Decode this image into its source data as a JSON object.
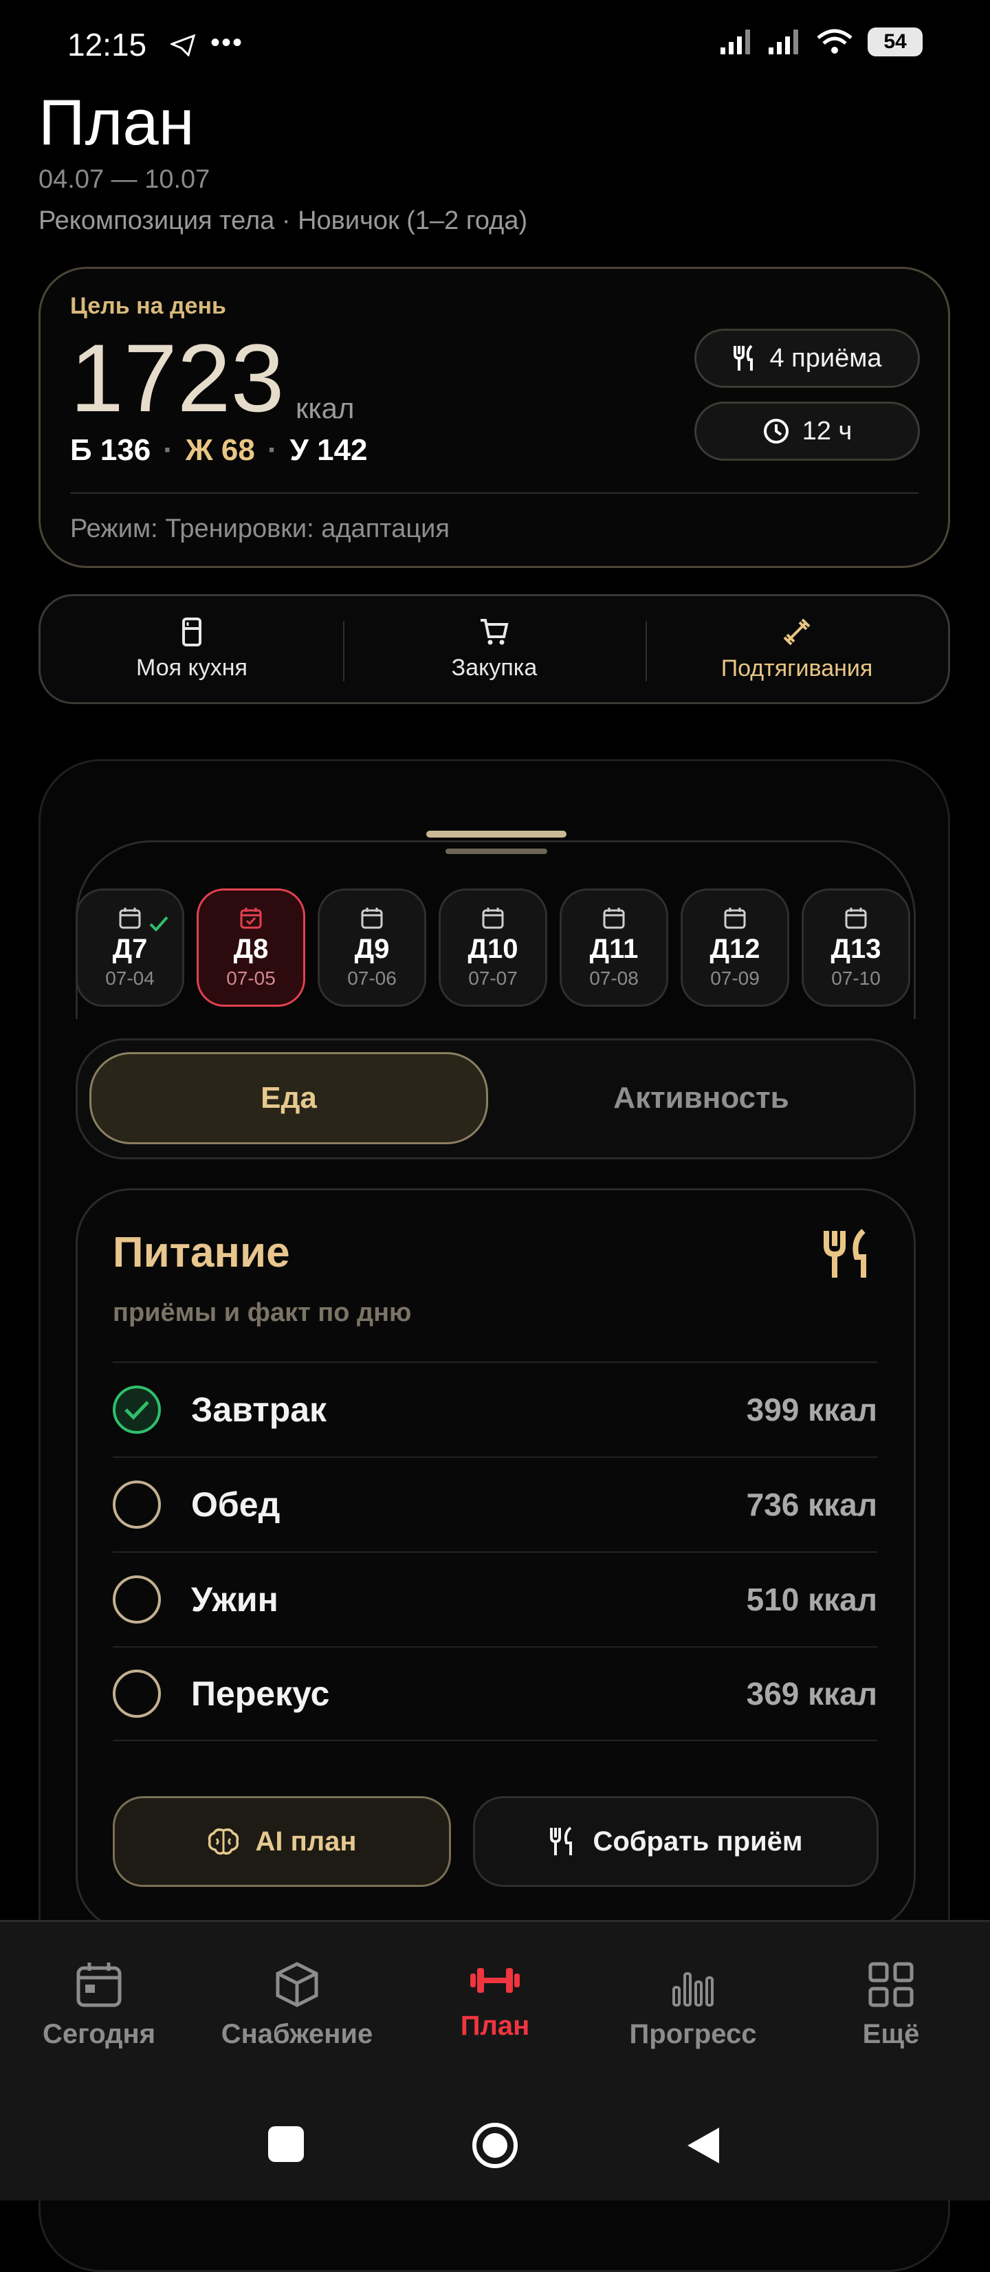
{
  "status": {
    "time": "12:15",
    "battery": "54"
  },
  "header": {
    "title": "План",
    "dates": "04.07 — 10.07",
    "subtitle": "Рекомпозиция тела · Новичок (1–2 года)"
  },
  "goal": {
    "label": "Цель на день",
    "kcal": "1723",
    "unit": "ккал",
    "protein": "Б 136",
    "fat": "Ж 68",
    "carbs": "У 142",
    "separator": "·",
    "meals_pill": "4 приёма",
    "hours_pill": "12 ч",
    "regime": "Режим: Тренировки: адаптация"
  },
  "quick_links": [
    {
      "label": "Моя кухня",
      "icon": "fridge-icon"
    },
    {
      "label": "Закупка",
      "icon": "cart-icon"
    },
    {
      "label": "Подтягивания",
      "icon": "dumbbell-icon"
    }
  ],
  "days": [
    {
      "label": "Д7",
      "date": "07-04",
      "done": true,
      "selected": false
    },
    {
      "label": "Д8",
      "date": "07-05",
      "done": false,
      "selected": true
    },
    {
      "label": "Д9",
      "date": "07-06",
      "done": false,
      "selected": false
    },
    {
      "label": "Д10",
      "date": "07-07",
      "done": false,
      "selected": false
    },
    {
      "label": "Д11",
      "date": "07-08",
      "done": false,
      "selected": false
    },
    {
      "label": "Д12",
      "date": "07-09",
      "done": false,
      "selected": false
    },
    {
      "label": "Д13",
      "date": "07-10",
      "done": false,
      "selected": false
    }
  ],
  "tabs": {
    "food": "Еда",
    "activity": "Активность"
  },
  "nutrition": {
    "title": "Питание",
    "subtitle": "приёмы и факт по дню",
    "meals": [
      {
        "name": "Завтрак",
        "kcal": "399 ккал",
        "done": true
      },
      {
        "name": "Обед",
        "kcal": "736 ккал",
        "done": false
      },
      {
        "name": "Ужин",
        "kcal": "510 ккал",
        "done": false
      },
      {
        "name": "Перекус",
        "kcal": "369 ккал",
        "done": false
      }
    ],
    "ai_button": "AI план",
    "build_button": "Собрать приём"
  },
  "nav": [
    {
      "label": "Сегодня",
      "icon": "calendar-icon"
    },
    {
      "label": "Снабжение",
      "icon": "box-icon"
    },
    {
      "label": "План",
      "icon": "dumbbell-icon",
      "active": true
    },
    {
      "label": "Прогресс",
      "icon": "bar-chart-icon"
    },
    {
      "label": "Ещё",
      "icon": "grid-icon"
    }
  ],
  "colors": {
    "accent_gold": "#e9c685",
    "active_red": "#f0353f",
    "done_green": "#2fbf6b"
  }
}
